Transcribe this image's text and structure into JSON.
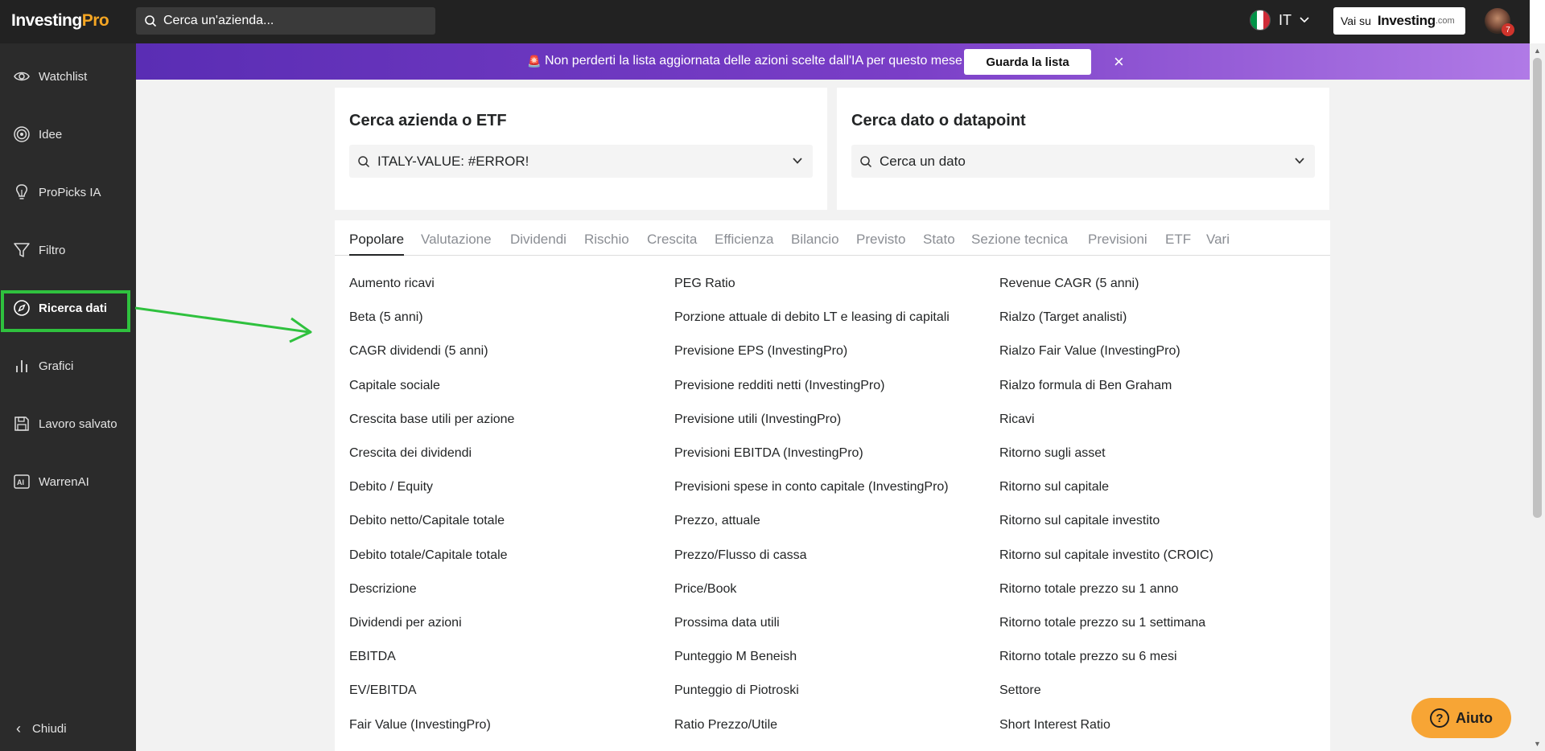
{
  "header": {
    "logo_main": "Investing",
    "logo_pro": "Pro",
    "search_placeholder": "Cerca un'azienda...",
    "language": "IT",
    "vai_su": "Vai su",
    "vai_brand": "Investing",
    "vai_domain": ".com",
    "notification_count": "7"
  },
  "sidebar": {
    "items": [
      {
        "label": "Watchlist",
        "icon": "eye-icon"
      },
      {
        "label": "Idee",
        "icon": "target-icon"
      },
      {
        "label": "ProPicks IA",
        "icon": "lightbulb-icon"
      },
      {
        "label": "Filtro",
        "icon": "filter-icon"
      },
      {
        "label": "Ricerca dati",
        "icon": "compass-icon",
        "active": true
      },
      {
        "label": "Grafici",
        "icon": "bar-chart-icon"
      },
      {
        "label": "Lavoro salvato",
        "icon": "save-icon"
      },
      {
        "label": "WarrenAI",
        "icon": "ai-icon"
      }
    ],
    "close_label": "Chiudi"
  },
  "banner": {
    "message": "Non perderti la lista aggiornata delle azioni scelte dall'IA per questo mese",
    "button": "Guarda la lista"
  },
  "company_search": {
    "title": "Cerca azienda o ETF",
    "value": "ITALY-VALUE: #ERROR!"
  },
  "datapoint_search": {
    "title": "Cerca dato o datapoint",
    "placeholder": "Cerca un dato"
  },
  "tabs": [
    "Popolare",
    "Valutazione",
    "Dividendi",
    "Rischio",
    "Crescita",
    "Efficienza",
    "Bilancio",
    "Previsto",
    "Stato",
    "Sezione tecnica",
    "Previsioni",
    "ETF",
    "Vari"
  ],
  "active_tab": "Popolare",
  "columns": [
    [
      "Aumento ricavi",
      "Beta (5 anni)",
      "CAGR dividendi (5 anni)",
      "Capitale sociale",
      "Crescita base utili per azione",
      "Crescita dei dividendi",
      "Debito / Equity",
      "Debito netto/Capitale totale",
      "Debito totale/Capitale totale",
      "Descrizione",
      "Dividendi per azioni",
      "EBITDA",
      "EV/EBITDA",
      "Fair Value (InvestingPro)"
    ],
    [
      "PEG Ratio",
      "Porzione attuale di debito LT e leasing di capitali",
      "Previsione EPS (InvestingPro)",
      "Previsione redditi netti (InvestingPro)",
      "Previsione utili (InvestingPro)",
      "Previsioni EBITDA (InvestingPro)",
      "Previsioni spese in conto capitale (InvestingPro)",
      "Prezzo, attuale",
      "Prezzo/Flusso di cassa",
      "Price/Book",
      "Prossima data utili",
      "Punteggio M Beneish",
      "Punteggio di Piotroski",
      "Ratio Prezzo/Utile"
    ],
    [
      "Revenue CAGR (5 anni)",
      "Rialzo (Target analisti)",
      "Rialzo Fair Value (InvestingPro)",
      "Rialzo formula di Ben Graham",
      "Ricavi",
      "Ritorno sugli asset",
      "Ritorno sul capitale",
      "Ritorno sul capitale investito",
      "Ritorno sul capitale investito (CROIC)",
      "Ritorno totale prezzo su 1 anno",
      "Ritorno totale prezzo su 1 settimana",
      "Ritorno totale prezzo su 6 mesi",
      "Settore",
      "Short Interest Ratio"
    ]
  ],
  "help": "Aiuto",
  "colors": {
    "accent_orange": "#f7a535",
    "highlight_green": "#2fc13e",
    "banner_purple": "#6a35bd"
  }
}
